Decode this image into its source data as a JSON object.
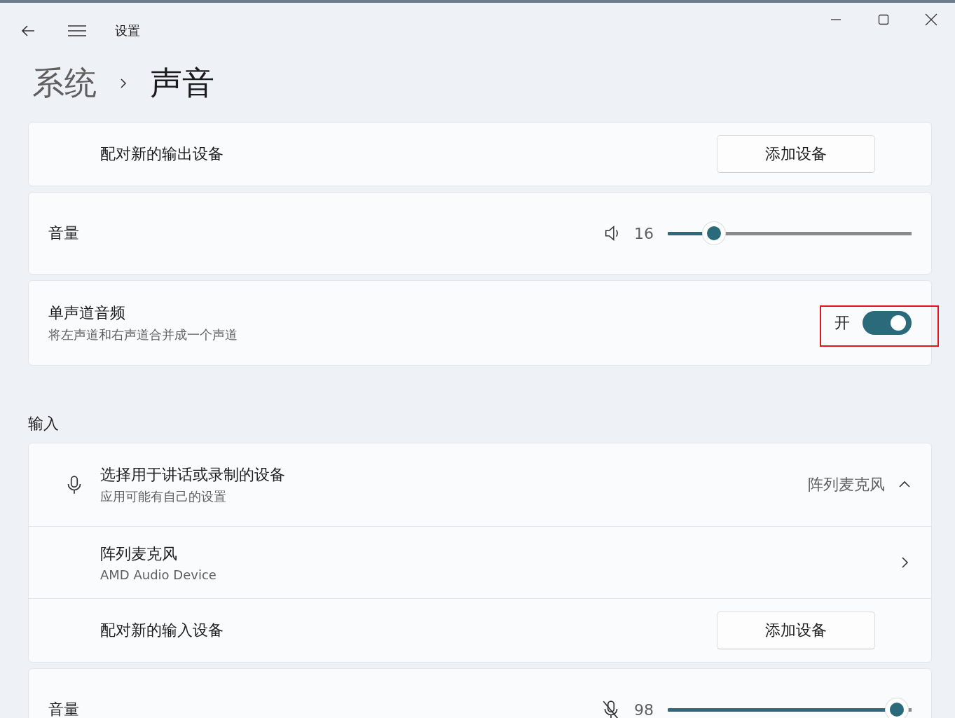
{
  "window": {
    "title": "设置"
  },
  "breadcrumb": {
    "parent": "系统",
    "current": "声音"
  },
  "output": {
    "pair_row": {
      "label": "配对新的输出设备",
      "button": "添加设备"
    },
    "volume": {
      "label": "音量",
      "kind": "speaker",
      "muted": false,
      "reading": "16",
      "level": 0.19
    },
    "mono": {
      "title": "单声道音频",
      "description": "将左声道和右声道合并成一个声道",
      "state_label": "开",
      "on": true
    }
  },
  "input": {
    "heading": "输入",
    "device_select": {
      "title": "选择用于讲话或录制的设备",
      "description": "应用可能有自己的设置",
      "value": "阵列麦克风",
      "expanded": true
    },
    "devices": [
      {
        "name": "阵列麦克风",
        "detail": "AMD Audio Device"
      }
    ],
    "pair_row": {
      "label": "配对新的输入设备",
      "button": "添加设备"
    },
    "volume": {
      "label": "音量",
      "kind": "microphone",
      "muted": true,
      "reading": "98",
      "level": 0.94
    }
  }
}
